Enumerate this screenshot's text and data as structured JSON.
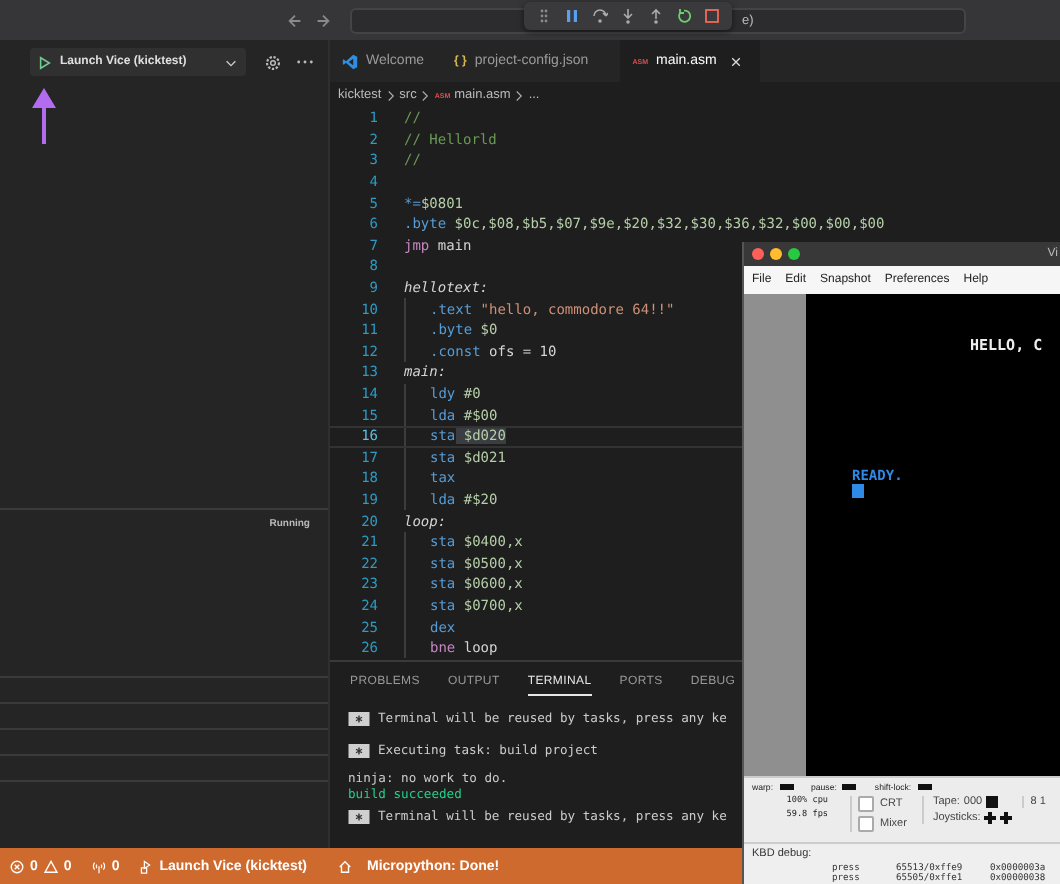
{
  "top_bar": {
    "command_center_text": "e)"
  },
  "sidebar": {
    "launch_config": "Launch Vice (kicktest)",
    "status": "Running"
  },
  "editor_tabs": [
    {
      "label": "Welcome",
      "kind": "welcome",
      "selected": false
    },
    {
      "label": "project-config.json",
      "kind": "json",
      "icon_text": "{ }",
      "selected": false
    },
    {
      "label": "main.asm",
      "kind": "asm",
      "icon_text": "ASM",
      "selected": true
    }
  ],
  "breadcrumbs": [
    {
      "label": "kicktest"
    },
    {
      "label": "src"
    },
    {
      "label": "main.asm",
      "badge": "ASM"
    },
    {
      "label": "..."
    }
  ],
  "code_lines": [
    {
      "number": "1",
      "current": false,
      "tokens": [
        {
          "kind": "comment",
          "text": "//"
        }
      ]
    },
    {
      "number": "2",
      "current": false,
      "tokens": [
        {
          "kind": "comment",
          "text": "// Hellorld"
        }
      ]
    },
    {
      "number": "3",
      "current": false,
      "tokens": [
        {
          "kind": "comment",
          "text": "//"
        }
      ]
    },
    {
      "number": "4",
      "current": false
    },
    {
      "number": "5",
      "current": false,
      "tokens": [
        {
          "kind": "directive",
          "text": "*="
        },
        {
          "kind": "number",
          "text": "$0801"
        }
      ]
    },
    {
      "number": "6",
      "current": false,
      "tokens": [
        {
          "kind": "directive",
          "text": ".byte"
        },
        {
          "kind": "number",
          "text": " $0c,$08,$b5,$07,$9e,$20,$32,$30,$36,$32,$00,$00,$00"
        }
      ]
    },
    {
      "number": "7",
      "current": false,
      "tokens": [
        {
          "kind": "control",
          "text": "jmp"
        },
        {
          "kind": "plain",
          "text": " main"
        }
      ]
    },
    {
      "number": "8",
      "current": false
    },
    {
      "number": "9",
      "current": false,
      "tokens": [
        {
          "kind": "label",
          "text": "hellotext:"
        }
      ],
      "children": [
        {
          "number": "10",
          "current": false,
          "tokens": [
            {
              "kind": "directive",
              "text": ".text"
            },
            {
              "kind": "string",
              "text": " \"hello, commodore 64!!\""
            }
          ]
        },
        {
          "number": "11",
          "current": false,
          "tokens": [
            {
              "kind": "directive",
              "text": ".byte"
            },
            {
              "kind": "number",
              "text": " $0"
            }
          ]
        },
        {
          "number": "12",
          "current": false,
          "tokens": [
            {
              "kind": "directive",
              "text": ".const"
            },
            {
              "kind": "plain",
              "text": " ofs = 10"
            }
          ]
        }
      ]
    },
    {
      "number": "13",
      "current": false,
      "tokens": [
        {
          "kind": "label",
          "text": "main:"
        }
      ],
      "children": [
        {
          "number": "14",
          "current": false,
          "tokens": [
            {
              "kind": "directive",
              "text": "ldy"
            },
            {
              "kind": "number",
              "text": " #0"
            }
          ]
        },
        {
          "number": "15",
          "current": false,
          "tokens": [
            {
              "kind": "directive",
              "text": "lda"
            },
            {
              "kind": "number",
              "text": " #$00"
            }
          ]
        },
        {
          "number": "16",
          "current": true,
          "tokens": [
            {
              "kind": "directive",
              "text": "sta"
            },
            {
              "kind": "number",
              "text": " $d020"
            }
          ]
        },
        {
          "number": "17",
          "current": false,
          "tokens": [
            {
              "kind": "directive",
              "text": "sta"
            },
            {
              "kind": "number",
              "text": " $d021"
            }
          ]
        },
        {
          "number": "18",
          "current": false,
          "tokens": [
            {
              "kind": "directive",
              "text": "tax"
            }
          ]
        },
        {
          "number": "19",
          "current": false,
          "tokens": [
            {
              "kind": "directive",
              "text": "lda"
            },
            {
              "kind": "number",
              "text": " #$20"
            }
          ]
        }
      ]
    },
    {
      "number": "20",
      "current": false,
      "tokens": [
        {
          "kind": "label",
          "text": "loop:"
        }
      ],
      "children": [
        {
          "number": "21",
          "current": false,
          "tokens": [
            {
              "kind": "directive",
              "text": "sta"
            },
            {
              "kind": "number",
              "text": " $0400,x"
            }
          ]
        },
        {
          "number": "22",
          "current": false,
          "tokens": [
            {
              "kind": "directive",
              "text": "sta"
            },
            {
              "kind": "number",
              "text": " $0500,x"
            }
          ]
        },
        {
          "number": "23",
          "current": false,
          "tokens": [
            {
              "kind": "directive",
              "text": "sta"
            },
            {
              "kind": "number",
              "text": " $0600,x"
            }
          ]
        },
        {
          "number": "24",
          "current": false,
          "tokens": [
            {
              "kind": "directive",
              "text": "sta"
            },
            {
              "kind": "number",
              "text": " $0700,x"
            }
          ]
        },
        {
          "number": "25",
          "current": false,
          "tokens": [
            {
              "kind": "directive",
              "text": "dex"
            }
          ]
        },
        {
          "number": "26",
          "current": false,
          "tokens": [
            {
              "kind": "control",
              "text": "bne"
            },
            {
              "kind": "plain",
              "text": " loop"
            }
          ]
        }
      ]
    }
  ],
  "panel": {
    "tabs": [
      {
        "label": "PROBLEMS",
        "selected": false
      },
      {
        "label": "OUTPUT",
        "selected": false
      },
      {
        "label": "TERMINAL",
        "selected": true
      },
      {
        "label": "PORTS",
        "selected": false
      },
      {
        "label": "DEBUG",
        "selected": false
      }
    ],
    "terminal_lines": [
      {
        "kind": "task",
        "text": "Terminal will be reused by tasks, press any ke"
      },
      {
        "kind": "task",
        "text": "Executing task: build project"
      },
      {
        "kind": "plain",
        "text": "ninja: no work to do."
      },
      {
        "kind": "success",
        "text": "build succeeded"
      },
      {
        "kind": "task",
        "text": "Terminal will be reused by tasks, press any ke"
      }
    ]
  },
  "status_bar": {
    "errors": "0",
    "warnings": "0",
    "ports": "0",
    "launch": "Launch Vice (kicktest)",
    "message": "Micropython: Done!"
  },
  "vice": {
    "title": "Vi",
    "menu": [
      "File",
      "Edit",
      "Snapshot",
      "Preferences",
      "Help"
    ],
    "screen_lines": [
      {
        "kind": "output",
        "text": "HELLO, C"
      },
      {
        "kind": "prompt",
        "text": "READY."
      }
    ],
    "indicators": [
      "warp:",
      "pause:",
      "shift-lock:"
    ],
    "cpu": "100% cpu",
    "fps": "59.8 fps",
    "options": [
      {
        "label": "CRT",
        "checked": false
      },
      {
        "label": "Mixer",
        "checked": false
      }
    ],
    "tape_label": "Tape:",
    "tape_counter": "000",
    "joysticks_label": "Joysticks:",
    "drive": "8 1",
    "kbd_title": "KBD debug:",
    "kbd_rows": [
      {
        "action": "press",
        "code": "65513/0xffe9",
        "value": "0x0000003a"
      },
      {
        "action": "press",
        "code": "65505/0xffe1",
        "value": "0x00000038"
      }
    ]
  }
}
